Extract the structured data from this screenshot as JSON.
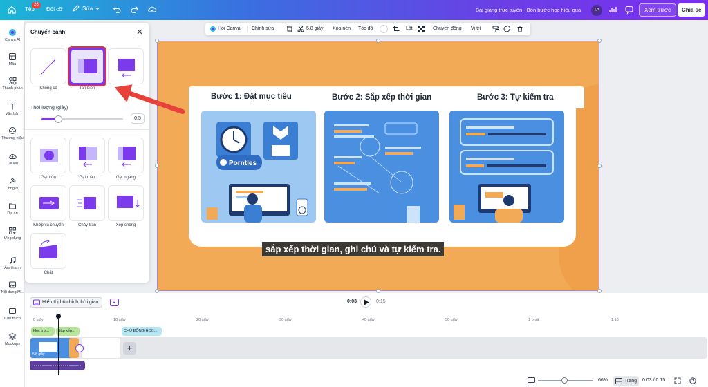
{
  "topbar": {
    "file_label": "Tệp",
    "file_badge": "26",
    "resize_label": "Đổi cỡ",
    "edit_label": "Sửa",
    "doc_title": "Bài giảng trực tuyến - Bốn bước học hiệu quả",
    "avatar_initials": "TA",
    "preview_label": "Xem trước",
    "share_label": "Chia sẻ"
  },
  "rail": {
    "items": [
      {
        "label": "Canva AI",
        "icon": "canva-ai-icon"
      },
      {
        "label": "Mẫu",
        "icon": "template-icon"
      },
      {
        "label": "Thành phần",
        "icon": "elements-icon"
      },
      {
        "label": "Văn bản",
        "icon": "text-icon"
      },
      {
        "label": "Thương hiệu",
        "icon": "brand-icon"
      },
      {
        "label": "Tải lên",
        "icon": "upload-icon"
      },
      {
        "label": "Công cụ",
        "icon": "tools-icon"
      },
      {
        "label": "Dự án",
        "icon": "folder-icon"
      },
      {
        "label": "Ứng dụng",
        "icon": "apps-icon"
      },
      {
        "label": "Âm thanh",
        "icon": "music-icon"
      },
      {
        "label": "Nội dung M...",
        "icon": "media-icon"
      },
      {
        "label": "Chú thích",
        "icon": "caption-icon"
      },
      {
        "label": "Mockups",
        "icon": "mockups-icon"
      }
    ]
  },
  "panel": {
    "title": "Chuyển cảnh",
    "duration_label": "Thời lượng (giây)",
    "duration_value": "0.5",
    "duration_fraction": 0.2,
    "top_tiles": [
      {
        "label": "Không có"
      },
      {
        "label": "Tan biến",
        "selected": true
      },
      {
        "label": "Đẩy"
      }
    ],
    "grid_tiles": [
      {
        "label": "Gạt tròn"
      },
      {
        "label": "Gạt màu"
      },
      {
        "label": "Gạt ngang"
      },
      {
        "label": "Khớp và chuyển"
      },
      {
        "label": "Chảy tràn"
      },
      {
        "label": "Xếp chồng"
      },
      {
        "label": "Chặt"
      }
    ]
  },
  "context_toolbar": {
    "ask_canva": "Hỏi Canva",
    "edit": "Chỉnh sửa",
    "duration": "5.8 giây",
    "remove_bg": "Xóa nền",
    "speed": "Tốc độ",
    "flip": "Lật",
    "animate": "Chuyển động",
    "position": "Vị trí"
  },
  "slide": {
    "steps": [
      {
        "title": "Bước 1: Đặt mục tiêu"
      },
      {
        "title": "Bước 2: Sắp xếp thời gian"
      },
      {
        "title": "Bước 3: Tự kiểm tra"
      }
    ],
    "img1_word": "Porntles",
    "subtitle": "sắp xếp thời gian, ghi chú và tự kiểm tra.",
    "colors": {
      "background": "#f3aa56",
      "card_blue": "#4a8fe0"
    }
  },
  "timeline": {
    "toggle_label": "Hiển thị bộ chỉnh thời gian",
    "current_time": "0:03",
    "total_time": "0:15",
    "ruler": [
      "0 giây",
      "10 giây",
      "20 giây",
      "30 giây",
      "40 giây",
      "50 giây",
      "1 phút",
      "1:10"
    ],
    "scenes": [
      {
        "label": "Học trự..."
      },
      {
        "label": "Sắp xếp..."
      },
      {
        "label": "CHỦ ĐỘNG HỌC..."
      }
    ],
    "clip_label": "5.8 giây"
  },
  "bottom_bar": {
    "zoom": "66%",
    "pages_label": "Trang",
    "time": "0:03 / 0:15"
  }
}
